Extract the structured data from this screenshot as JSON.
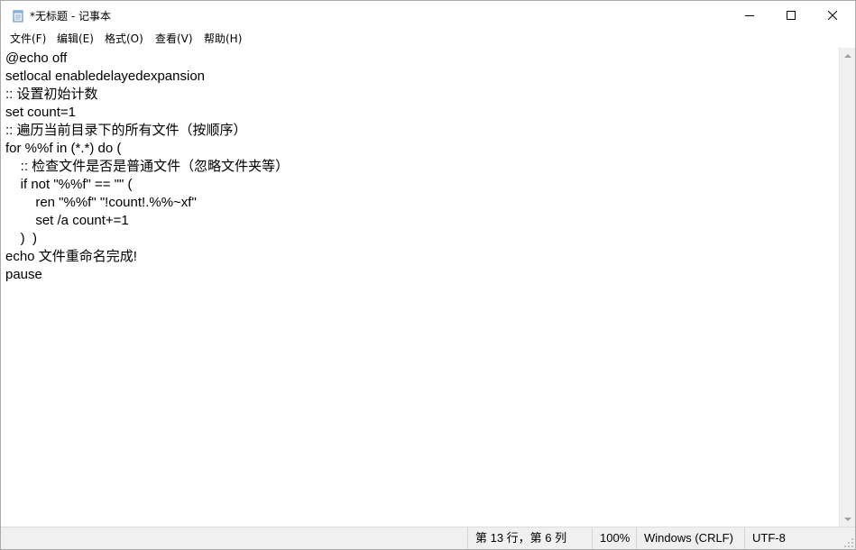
{
  "window": {
    "title": "*无标题 - 记事本",
    "app_icon": "notepad-icon"
  },
  "menu": {
    "items": [
      {
        "label": "文件(F)"
      },
      {
        "label": "编辑(E)"
      },
      {
        "label": "格式(O)"
      },
      {
        "label": "查看(V)"
      },
      {
        "label": "帮助(H)"
      }
    ]
  },
  "editor": {
    "lines": [
      "@echo off",
      "setlocal enabledelayedexpansion",
      ":: 设置初始计数",
      "set count=1",
      ":: 遍历当前目录下的所有文件（按顺序）",
      "for %%f in (*.*) do (",
      "    :: 检查文件是否是普通文件（忽略文件夹等）",
      "    if not \"%%f\" == \"\" (",
      "        ren \"%%f\" \"!count!.%%~xf\"",
      "        set /a count+=1",
      "    )  )",
      "echo 文件重命名完成!",
      "pause"
    ]
  },
  "status": {
    "position": "第 13 行，第 6 列",
    "zoom": "100%",
    "line_ending": "Windows (CRLF)",
    "encoding": "UTF-8"
  }
}
